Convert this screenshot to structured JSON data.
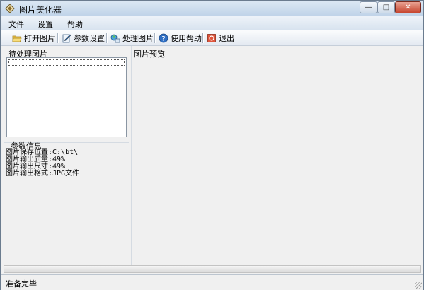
{
  "window": {
    "title": "图片美化器"
  },
  "menu": {
    "items": [
      "文件",
      "设置",
      "帮助"
    ]
  },
  "toolbar": {
    "open_label": "打开图片",
    "settings_label": "参数设置",
    "process_label": "处理图片",
    "help_label": "使用帮助",
    "exit_label": "退出"
  },
  "left": {
    "pending_label": "待处理图片",
    "params_label": "参数信息",
    "params": [
      "图片保存位置:C:\\bt\\",
      "图片输出质量:49%",
      "图片输出尺寸:49%",
      "图片输出格式:JPG文件"
    ]
  },
  "preview": {
    "label": "图片预览"
  },
  "status": {
    "text": "准备完毕"
  },
  "colors": {
    "titlebar": "#bfd3e8",
    "close_button": "#c7462f",
    "window_bg": "#f0f0f0"
  }
}
